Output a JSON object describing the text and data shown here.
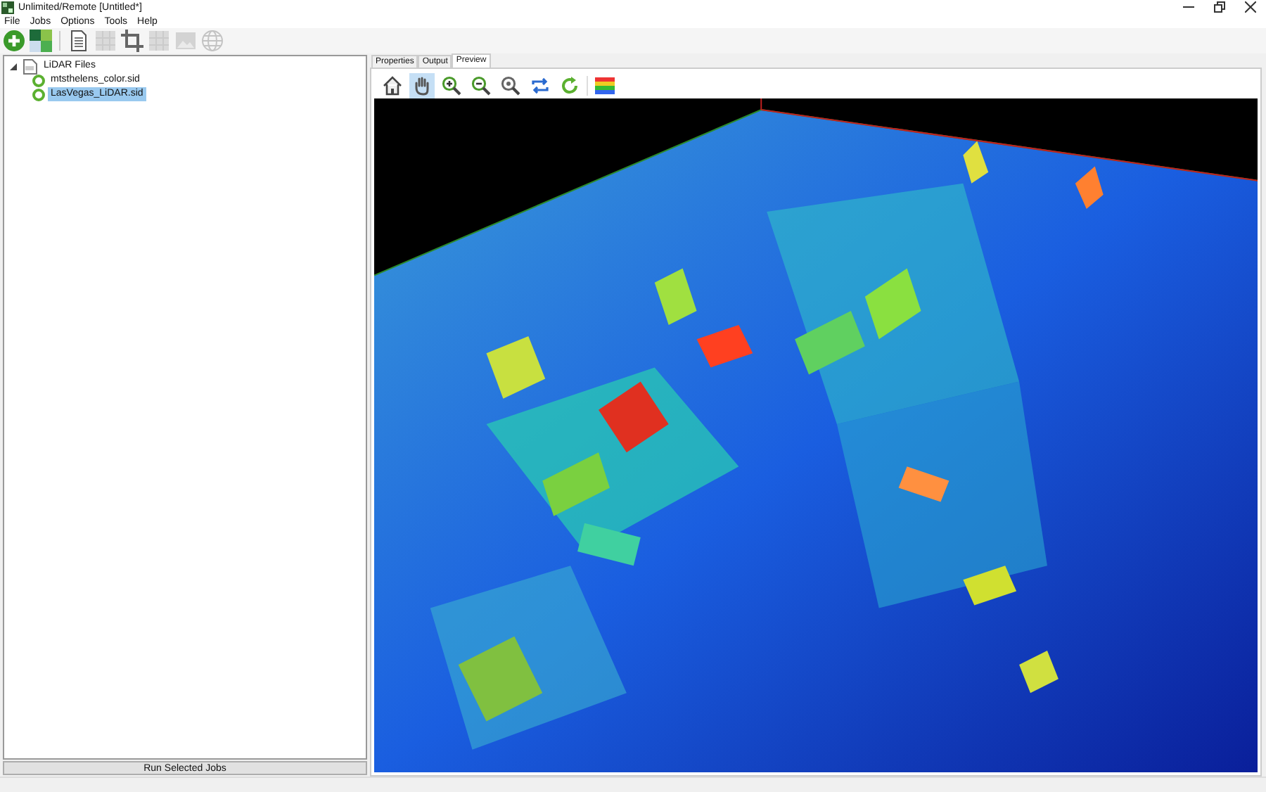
{
  "window": {
    "title": "Unlimited/Remote [Untitled*]"
  },
  "menu": [
    "File",
    "Jobs",
    "Options",
    "Tools",
    "Help"
  ],
  "toolbar": [
    {
      "kind": "add",
      "disabled": false
    },
    {
      "kind": "mosaic",
      "disabled": false
    },
    {
      "kind": "document",
      "disabled": false
    },
    {
      "kind": "grid",
      "disabled": true
    },
    {
      "kind": "crop",
      "disabled": false
    },
    {
      "kind": "tiles",
      "disabled": true
    },
    {
      "kind": "image",
      "disabled": true
    },
    {
      "kind": "globe",
      "disabled": true
    }
  ],
  "tree": {
    "label": "LiDAR Files",
    "expanded": true,
    "children": [
      {
        "label": "mtsthelens_color.sid",
        "selected": false
      },
      {
        "label": "LasVegas_LiDAR.sid",
        "selected": true
      }
    ]
  },
  "run_button": "Run Selected Jobs",
  "tabs": [
    {
      "label": "Properties",
      "selected": false
    },
    {
      "label": "Output",
      "selected": false
    },
    {
      "label": "Preview",
      "selected": true
    }
  ],
  "preview_tools": [
    {
      "kind": "home",
      "selected": false
    },
    {
      "kind": "pan",
      "selected": true
    },
    {
      "kind": "zoom-in",
      "selected": false
    },
    {
      "kind": "zoom-out",
      "selected": false
    },
    {
      "kind": "zoom-fit",
      "selected": false
    },
    {
      "kind": "swap",
      "selected": false
    },
    {
      "kind": "refresh",
      "selected": false
    },
    {
      "kind": "palette",
      "selected": false
    }
  ]
}
